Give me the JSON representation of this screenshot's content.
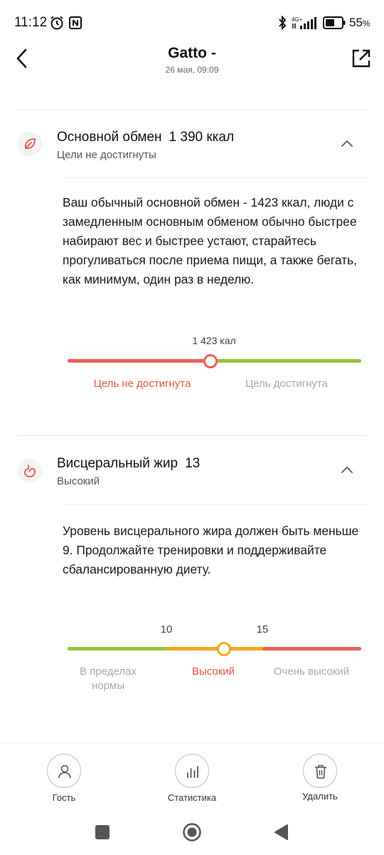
{
  "status_bar": {
    "time": "11:12",
    "network_label": "4G+",
    "battery_percent": "55",
    "battery_unit": "%",
    "icons": [
      "alarm-icon",
      "nfc-icon",
      "bluetooth-icon",
      "signal-icon",
      "battery-icon"
    ]
  },
  "header": {
    "title": "Gatto -",
    "subtitle": "26 мая, 09:09",
    "icons": [
      "back-arrow-icon",
      "share-icon"
    ]
  },
  "bmr_section": {
    "icon": "leaf-icon",
    "title": "Основной обмен",
    "value": "1 390 ккал",
    "status": "Цели не достигнуты",
    "description": "Ваш обычный основной обмен - 1423 ккал, люди с замедленным основным обменом обычно быстрее набирают вес и быстрее устают, старайтесь прогуливаться после приема пищи, а также бегать, как минимум, один раз в неделю.",
    "scale": {
      "threshold_label": "1 423 кал",
      "left_label": "Цель не достигнута",
      "right_label": "Цель достигнута",
      "marker_fraction": 0.49,
      "colors": {
        "below": "#f0605a",
        "above": "#99c33a"
      }
    }
  },
  "visceral_section": {
    "icon": "stomach-icon",
    "title": "Висцеральный жир",
    "value": "13",
    "status": "Высокий",
    "description": "Уровень висцерального жира должен быть меньше 9. Продолжайте тренировки и поддерживайте сбалансированную диету.",
    "scale": {
      "tick_1": "10",
      "tick_2": "15",
      "label_normal": "В пределах нормы",
      "label_high": "Высокий",
      "label_very_high": "Очень высокий",
      "marker_value": 13,
      "colors": {
        "normal": "#99c33a",
        "high": "#f3a81a",
        "very_high": "#f0605a"
      }
    }
  },
  "bottom_nav": {
    "guest": "Гость",
    "stats": "Статистика",
    "delete": "Удалить"
  },
  "accent_colors": {
    "red": "#e8524a",
    "green": "#99c33a",
    "orange": "#f3a81a"
  }
}
